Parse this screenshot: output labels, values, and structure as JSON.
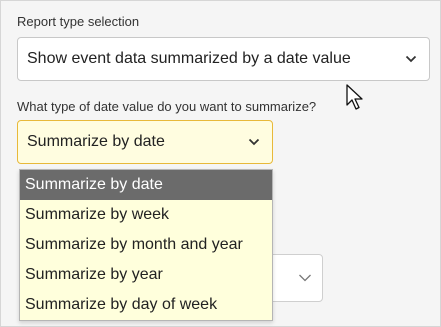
{
  "report_type": {
    "label": "Report type selection",
    "selected": "Show event data summarized by a date value",
    "chevron_icon": "chevron-down-icon"
  },
  "date_type": {
    "label": "What type of date value do you want to summarize?",
    "selected": "Summarize by date",
    "chevron_icon": "chevron-down-icon",
    "options": [
      "Summarize by date",
      "Summarize by week",
      "Summarize by month and year",
      "Summarize by year",
      "Summarize by day of week"
    ],
    "highlighted_index": 0
  },
  "hidden_select": {
    "chevron_icon": "chevron-down-icon"
  },
  "colors": {
    "dropdown_bg": "#ffffdc",
    "selected_bg": "#6b6b6b",
    "focus_border": "#e8b93a"
  },
  "cursor_icon": "mouse-pointer-icon"
}
